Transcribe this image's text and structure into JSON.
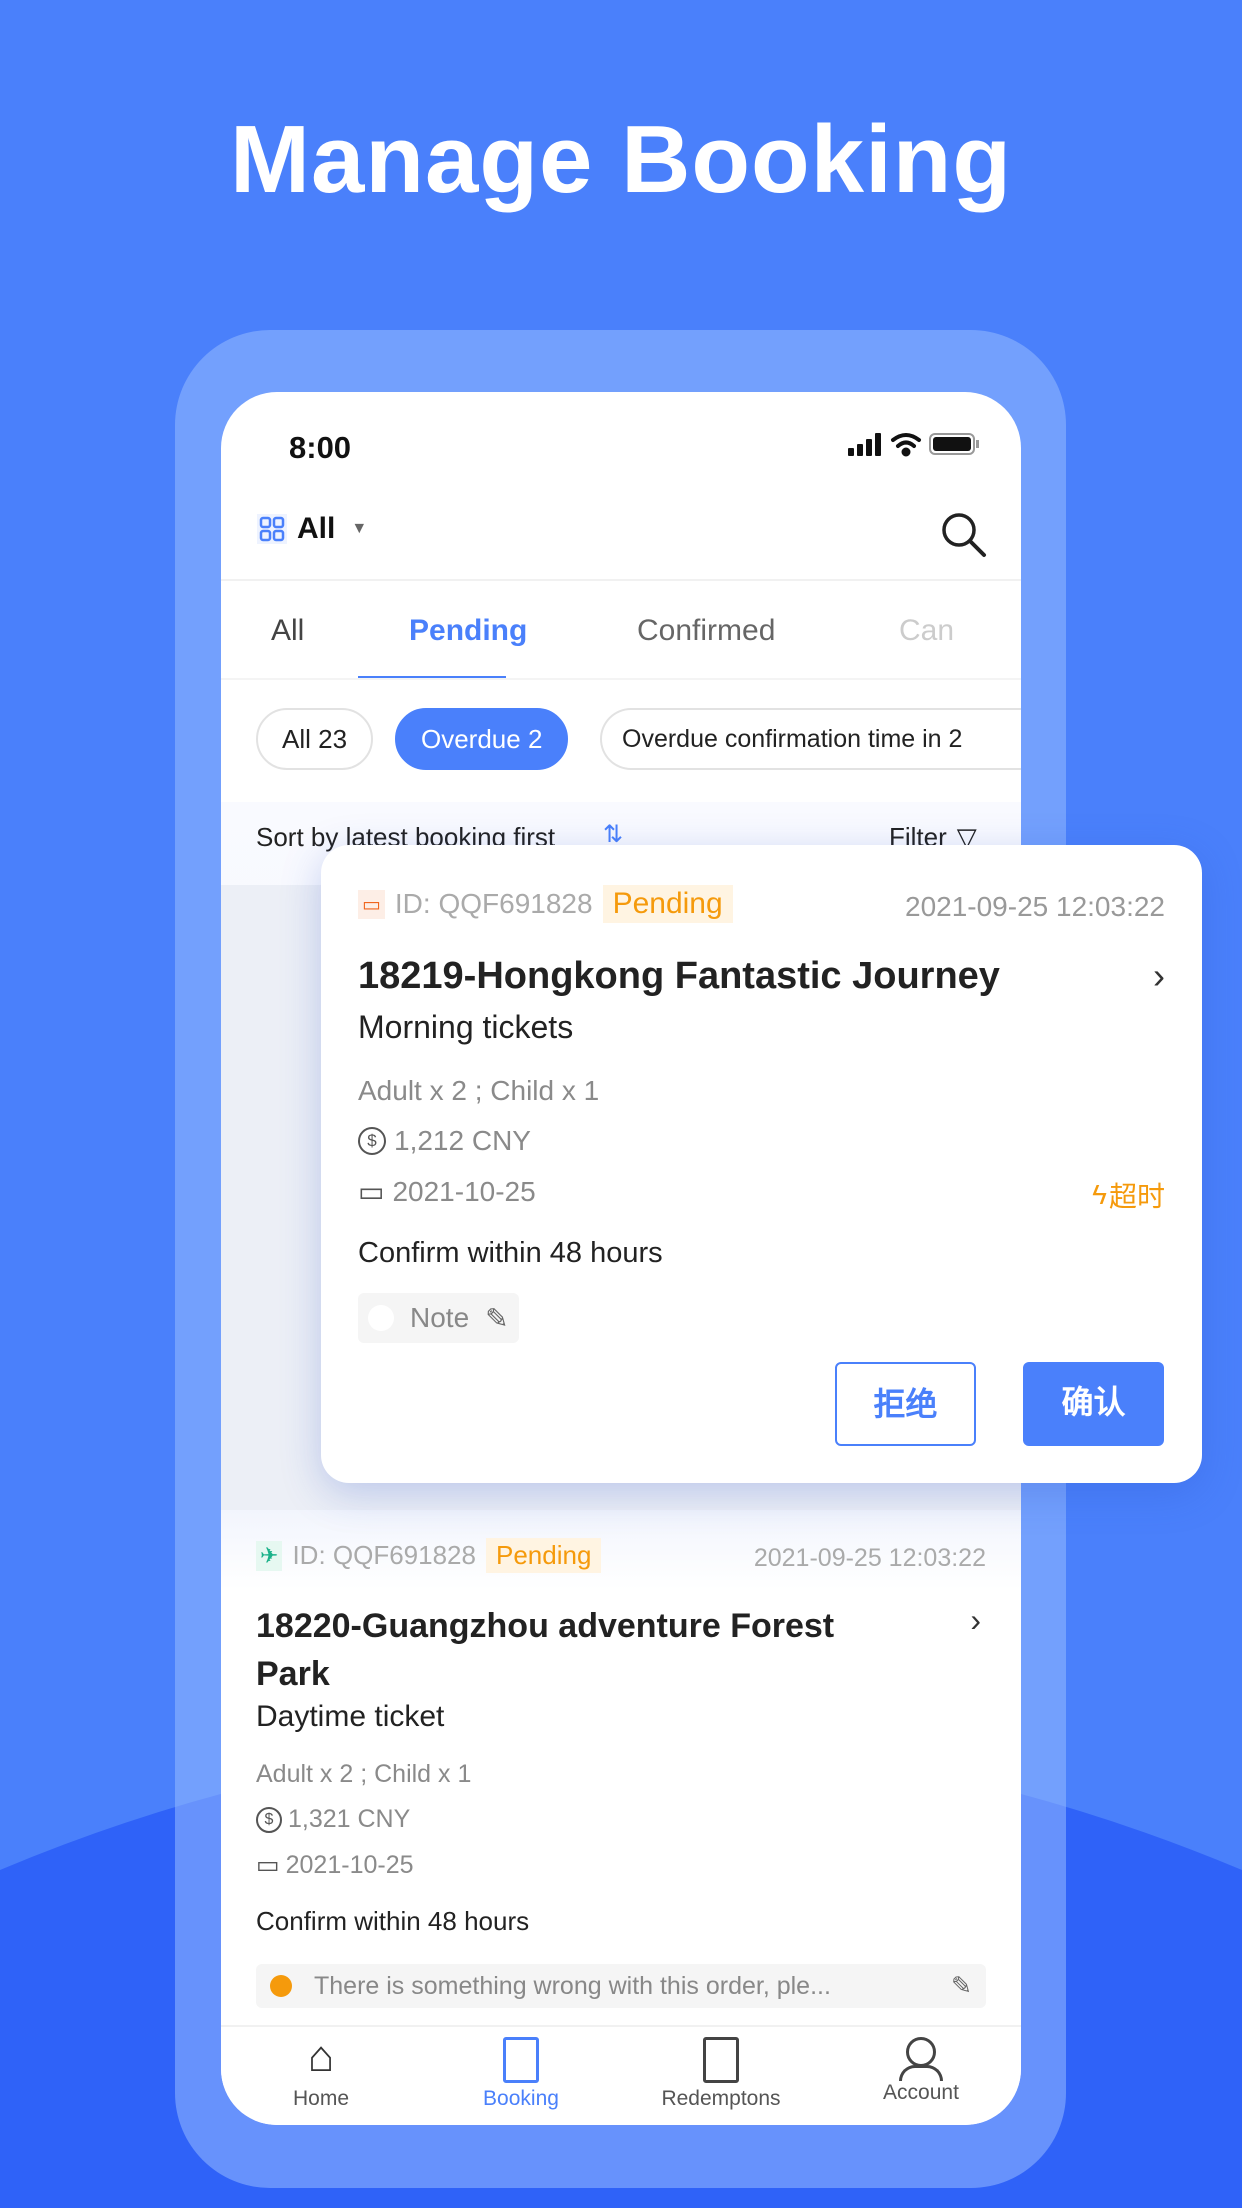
{
  "headline": "Manage Booking",
  "colors": {
    "background": "#4a80fb",
    "accent": "#4a80fb",
    "pending": "#f59a0c"
  },
  "status_bar": {
    "time": "8:00",
    "icons": [
      "signal-icon",
      "wifi-icon",
      "battery-icon"
    ]
  },
  "header": {
    "selector_label": "All",
    "icon": "grid-icon"
  },
  "tabs": [
    {
      "label": "All"
    },
    {
      "label": "Pending",
      "active": true
    },
    {
      "label": "Confirmed"
    },
    {
      "label": "Can"
    }
  ],
  "chips": [
    {
      "label": "All 23"
    },
    {
      "label": "Overdue 2",
      "active": true
    },
    {
      "label": "Overdue confirmation time in 2"
    }
  ],
  "sort": {
    "label": "Sort by latest booking first",
    "filter_label": "Filter"
  },
  "bookings": [
    {
      "id": "ID: QQF691828",
      "status": "Pending",
      "datetime": "2021-09-25 12:03:22",
      "title": "18219-Hongkong Fantastic Journey",
      "subtitle": "Morning tickets",
      "guests": "Adult x 2 ; Child x 1",
      "price": "1,212 CNY",
      "date": "2021-10-25",
      "overdue": "超时",
      "confirm": "Confirm within 48 hours",
      "note": "Note",
      "reject_label": "拒绝",
      "confirm_label": "确认"
    },
    {
      "id": "ID: QQF691828",
      "status": "Pending",
      "datetime": "2021-09-25 12:03:22",
      "title": "18220-Guangzhou adventure Forest Park",
      "subtitle": "Daytime ticket",
      "guests": "Adult x 2 ; Child x 1",
      "price": "1,321 CNY",
      "date": "2021-10-25",
      "confirm": "Confirm within 48 hours",
      "note": "There is something wrong with this order, ple..."
    }
  ],
  "bottom_nav": [
    {
      "label": "Home"
    },
    {
      "label": "Booking",
      "active": true
    },
    {
      "label": "Redemptons"
    },
    {
      "label": "Account"
    }
  ]
}
